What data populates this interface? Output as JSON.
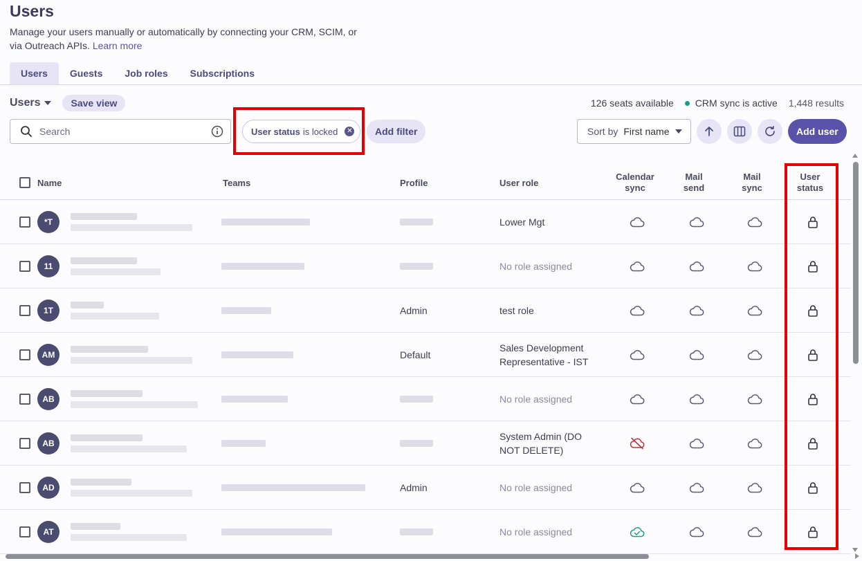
{
  "header": {
    "title": "Users",
    "subtitle": "Manage your users manually or automatically by connecting your CRM, SCIM, or via Outreach APIs.",
    "learn_more": "Learn more"
  },
  "tabs": [
    {
      "label": "Users",
      "active": true
    },
    {
      "label": "Guests",
      "active": false
    },
    {
      "label": "Job roles",
      "active": false
    },
    {
      "label": "Subscriptions",
      "active": false
    }
  ],
  "toolbar": {
    "view_label": "Users",
    "save_view": "Save view",
    "seats": "126 seats available",
    "crm_sync": "CRM sync is active",
    "results": "1,448 results",
    "search_placeholder": "Search",
    "filter_field": "User status",
    "filter_value": "is locked",
    "add_filter": "Add filter",
    "sort_label": "Sort by",
    "sort_value": "First name",
    "add_user": "Add user"
  },
  "table": {
    "columns": {
      "name": "Name",
      "teams": "Teams",
      "profile": "Profile",
      "user_role": "User role",
      "calendar_sync": "Calendar sync",
      "mail_send": "Mail send",
      "mail_sync": "Mail sync",
      "user_status": "User status"
    },
    "rows": [
      {
        "initials": "*T",
        "profile": "",
        "role": "Lower Mgt",
        "role_muted": false,
        "calendar": "normal"
      },
      {
        "initials": "11",
        "profile": "",
        "role": "No role assigned",
        "role_muted": true,
        "calendar": "normal"
      },
      {
        "initials": "1T",
        "profile": "Admin",
        "role": "test role",
        "role_muted": false,
        "calendar": "normal"
      },
      {
        "initials": "AM",
        "profile": "Default",
        "role": "Sales Development Representative - IST",
        "role_muted": false,
        "calendar": "normal"
      },
      {
        "initials": "AB",
        "profile": "",
        "role": "No role assigned",
        "role_muted": true,
        "calendar": "normal"
      },
      {
        "initials": "AB",
        "profile": "",
        "role": "System Admin (DO NOT DELETE)",
        "role_muted": false,
        "calendar": "error"
      },
      {
        "initials": "AD",
        "profile": "Admin",
        "role": "No role assigned",
        "role_muted": true,
        "calendar": "normal"
      },
      {
        "initials": "AT",
        "profile": "",
        "role": "No role assigned",
        "role_muted": true,
        "calendar": "success"
      }
    ]
  },
  "colors": {
    "accent": "#5a52a8",
    "sync_active": "#1a9e87",
    "sync_error": "#c0303a",
    "highlight": "#e60000"
  }
}
